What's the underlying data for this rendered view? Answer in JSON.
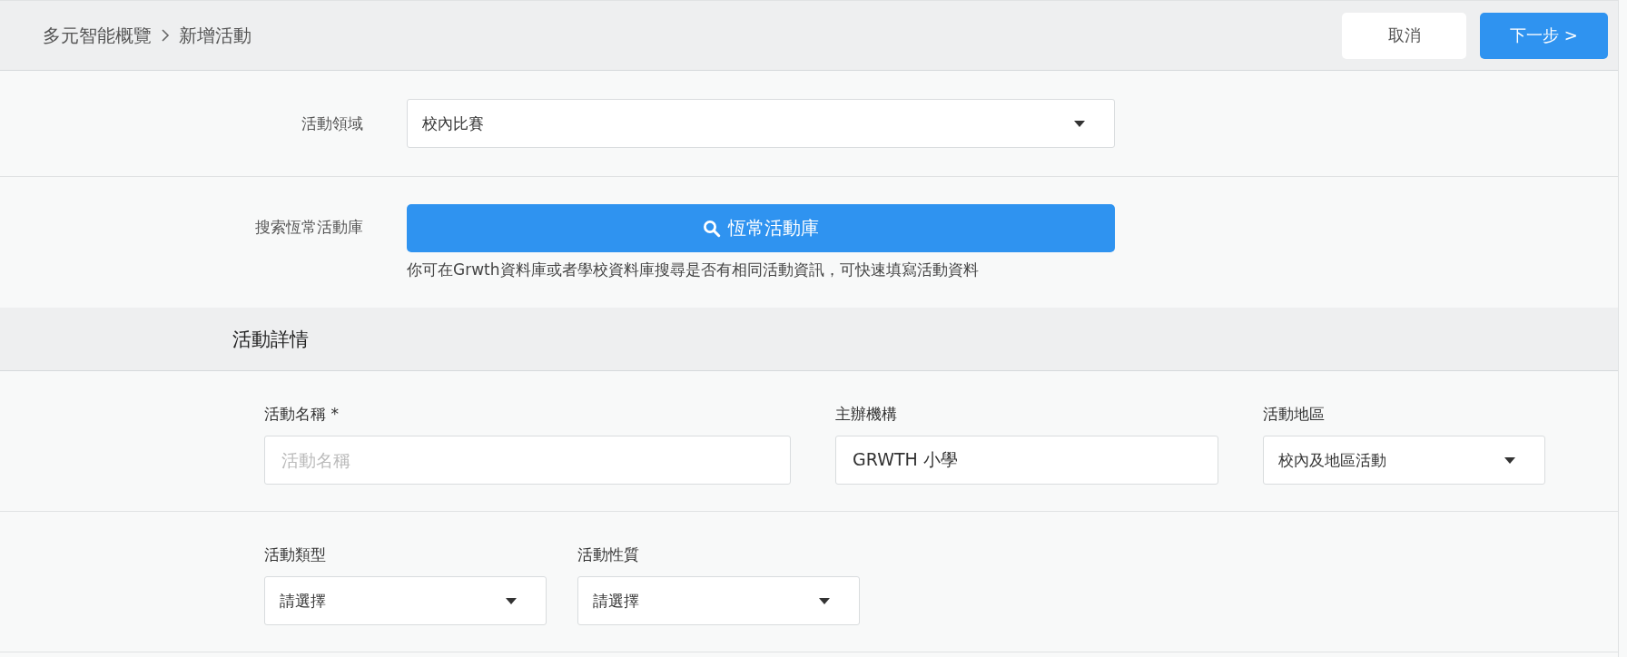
{
  "breadcrumb": [
    {
      "label": "多元智能概覽"
    },
    {
      "label": "新增活動"
    }
  ],
  "header_buttons": [
    {
      "label": "取消",
      "kind": "secondary"
    },
    {
      "label": "下一步 >",
      "kind": "primary"
    }
  ],
  "form_rows": [
    {
      "label": "活動領域",
      "kind": "select",
      "value": "校內比賽"
    },
    {
      "label": "搜索恆常活動庫",
      "kind": "search_button",
      "button": "恆常活動庫",
      "hint": "你可在Grwth資料庫或者學校資料庫搜尋是否有相同活動資訊，可快速填寫活動資料"
    }
  ],
  "section": {
    "title": "活動詳情"
  },
  "field_rows": [
    [
      {
        "label": "活動名稱 *",
        "kind": "text",
        "placeholder": "活動名稱"
      },
      {
        "label": "主辦機構",
        "kind": "text",
        "value": "GRWTH 小學"
      },
      {
        "label": "活動地區",
        "kind": "select",
        "value": "校內及地區活動"
      }
    ],
    [
      {
        "label": "活動類型",
        "kind": "select",
        "value": "請選擇"
      },
      {
        "label": "活動性質",
        "kind": "select",
        "value": "請選擇"
      }
    ]
  ]
}
